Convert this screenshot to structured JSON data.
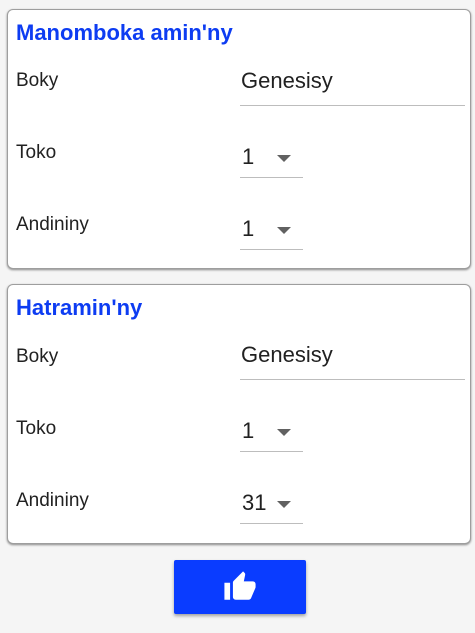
{
  "from_card": {
    "title": "Manomboka amin'ny",
    "book_label": "Boky",
    "book_value": "Genesisy",
    "chapter_label": "Toko",
    "chapter_value": "1",
    "verse_label": "Andininy",
    "verse_value": "1"
  },
  "to_card": {
    "title": "Hatramin'ny",
    "book_label": "Boky",
    "book_value": "Genesisy",
    "chapter_label": "Toko",
    "chapter_value": "1",
    "verse_label": "Andininy",
    "verse_value": "31"
  },
  "confirm_button": {
    "icon": "thumbs-up-icon"
  },
  "colors": {
    "accent": "#0a3cff",
    "title": "#0d3cf2",
    "background": "#f5f5f5"
  }
}
